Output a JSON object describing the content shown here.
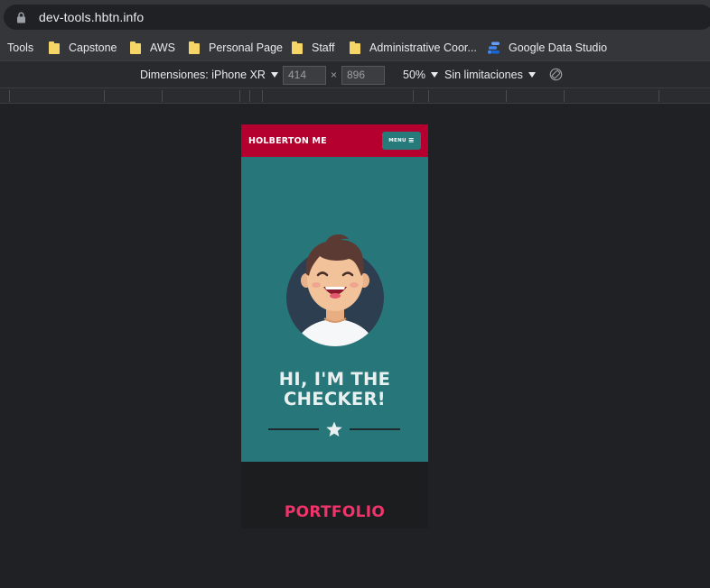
{
  "browser": {
    "url": "dev-tools.hbtn.info"
  },
  "bookmarks": [
    {
      "label": "Tools",
      "icon": "none"
    },
    {
      "label": "Capstone",
      "icon": "folder-icon"
    },
    {
      "label": "AWS",
      "icon": "folder-icon"
    },
    {
      "label": "Personal Page",
      "icon": "folder-icon"
    },
    {
      "label": "Staff",
      "icon": "folder-icon"
    },
    {
      "label": "Administrative Coor...",
      "icon": "folder-icon"
    },
    {
      "label": "Google Data Studio",
      "icon": "data-studio-icon"
    }
  ],
  "device_toolbar": {
    "dimensions_label": "Dimensiones: iPhone XR",
    "width": "414",
    "height": "896",
    "separator": "×",
    "zoom": "50%",
    "throttling": "Sin limitaciones"
  },
  "site": {
    "brand": "HOLBERTON ME",
    "menu_label": "MENU",
    "menu_icon": "≡",
    "hero_title_line1": "HI, I'M THE",
    "hero_title_line2": "CHECKER!",
    "portfolio_title": "PORTFOLIO",
    "colors": {
      "header": "#b5002f",
      "hero": "#27777a",
      "accent": "#f0336a",
      "menu_button": "#267a7a"
    }
  }
}
